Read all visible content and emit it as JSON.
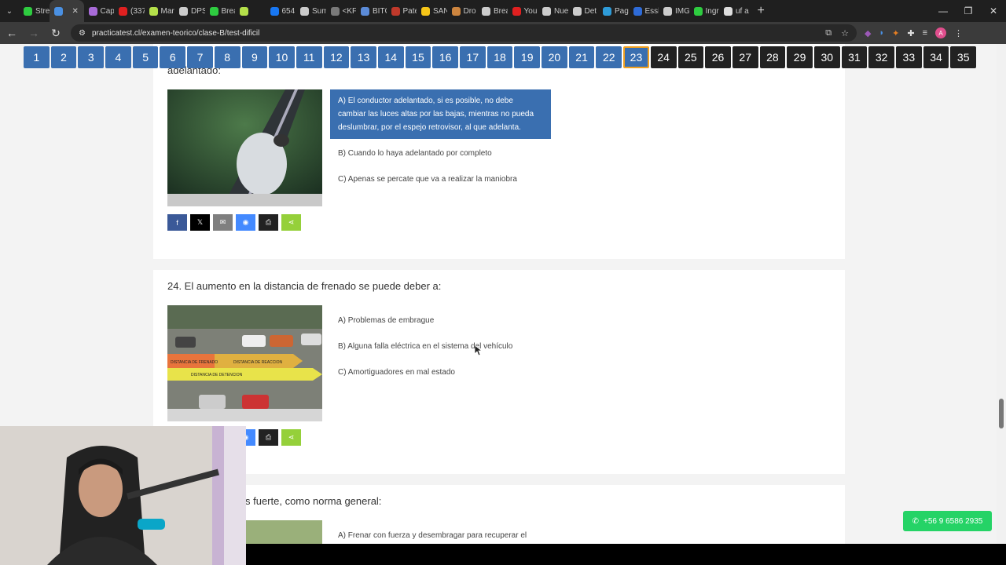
{
  "browser": {
    "tabs": [
      {
        "label": "Stre",
        "color": "#2ecc40"
      },
      {
        "label": "",
        "color": "#4a90e2",
        "active": true
      },
      {
        "label": "Cap",
        "color": "#a86bd8"
      },
      {
        "label": "(337",
        "color": "#e02020"
      },
      {
        "label": "Mar",
        "color": "#b4e04a"
      },
      {
        "label": "DPS",
        "color": "#cccccc"
      },
      {
        "label": "Brea",
        "color": "#2ecc40"
      },
      {
        "label": "",
        "color": "#b4e04a"
      },
      {
        "label": "654",
        "color": "#1877f2"
      },
      {
        "label": "Sum",
        "color": "#cccccc"
      },
      {
        "label": "<KF",
        "color": "#7a7a7a"
      },
      {
        "label": "BITC",
        "color": "#5b8bd8"
      },
      {
        "label": "Pate",
        "color": "#c0392b"
      },
      {
        "label": "SAN",
        "color": "#f5c518"
      },
      {
        "label": "Dro",
        "color": "#cd853f"
      },
      {
        "label": "Brea",
        "color": "#cccccc"
      },
      {
        "label": "You",
        "color": "#e02020"
      },
      {
        "label": "Nue",
        "color": "#cccccc"
      },
      {
        "label": "Det",
        "color": "#cccccc"
      },
      {
        "label": "Pag",
        "color": "#2e9bd8"
      },
      {
        "label": "Essl",
        "color": "#2e6bd8"
      },
      {
        "label": "IMG",
        "color": "#cccccc"
      },
      {
        "label": "Ingr",
        "color": "#2ecc40"
      },
      {
        "label": "uf a",
        "color": "#dddddd"
      }
    ],
    "url": "practicatest.cl/examen-teorico/clase-B/test-dificil"
  },
  "question_nav": {
    "numbers": [
      "1",
      "2",
      "3",
      "4",
      "5",
      "6",
      "7",
      "8",
      "9",
      "10",
      "11",
      "12",
      "13",
      "14",
      "15",
      "16",
      "17",
      "18",
      "19",
      "20",
      "21",
      "22",
      "23",
      "24",
      "25",
      "26",
      "27",
      "28",
      "29",
      "30",
      "31",
      "32",
      "33",
      "34",
      "35"
    ],
    "answered_count": 22,
    "current": "23"
  },
  "q23": {
    "title_fragment": "adelantado:",
    "answers": [
      "A) El conductor adelantado, si es posible, no debe cambiar las luces altas por las bajas, mientras no pueda deslumbrar, por el espejo retrovisor, al que adelanta.",
      "B) Cuando lo haya adelantado por completo",
      "C) Apenas se percate que va a realizar la maniobra"
    ]
  },
  "q24": {
    "title": "24. El aumento en la distancia de frenado se puede deber a:",
    "answers": [
      "A) Problemas de embrague",
      "B) Alguna falla eléctrica en el sistema del vehículo",
      "C) Amortiguadores en mal estado"
    ],
    "image_labels": [
      "DISTANCIA DE FRENADO",
      "DISTANCIA DE REACCION",
      "DISTANCIA DE DETENCION"
    ]
  },
  "q25": {
    "title_fragment": "s fuerte, como norma general:",
    "answers": [
      "A) Frenar con fuerza y desembragar para recuperar el control del vehículo"
    ]
  },
  "share": [
    "f",
    "𝕏",
    "✉",
    "◉",
    "⎙",
    "⋖"
  ],
  "whatsapp": {
    "label": "+56 9 6586 2935"
  }
}
